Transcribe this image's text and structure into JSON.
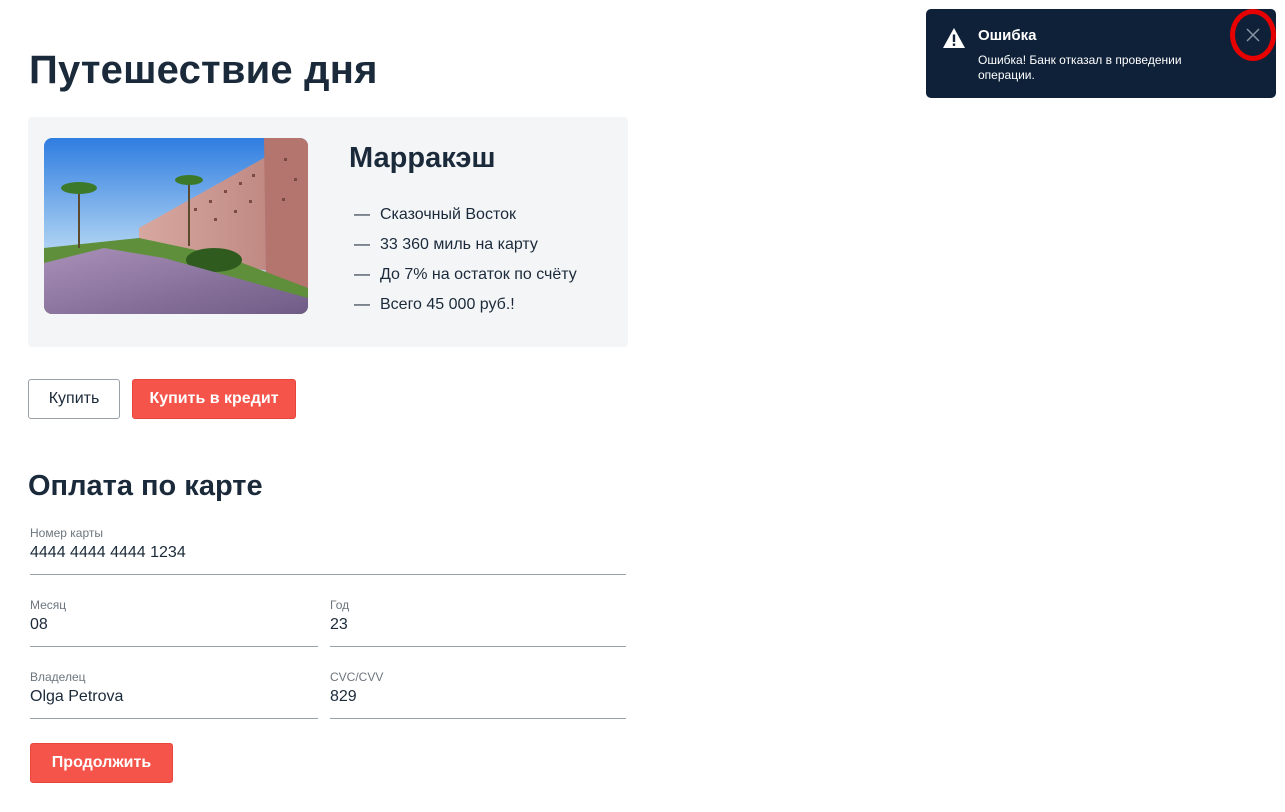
{
  "page": {
    "title": "Путешествие дня"
  },
  "offer": {
    "title": "Марракэш",
    "image_alt": "marrakesh-city-wall-photo",
    "features": [
      "Сказочный Восток",
      "33 360 миль на карту",
      "До 7% на остаток по счёту",
      "Всего 45 000 руб.!"
    ],
    "dash": "—"
  },
  "actions": {
    "buy_label": "Купить",
    "buy_credit_label": "Купить в кредит"
  },
  "payment": {
    "title": "Оплата по карте",
    "fields": {
      "card_number": {
        "label": "Номер карты",
        "value": "4444 4444 4444 1234"
      },
      "month": {
        "label": "Месяц",
        "value": "08"
      },
      "year": {
        "label": "Год",
        "value": "23"
      },
      "owner": {
        "label": "Владелец",
        "value": "Olga Petrova"
      },
      "cvc": {
        "label": "CVC/CVV",
        "value": "829"
      }
    },
    "continue_label": "Продолжить"
  },
  "notification": {
    "title": "Ошибка",
    "message": "Ошибка! Банк отказал в проведении операции.",
    "icon": "warning-icon",
    "close_icon": "close-icon",
    "highlight_color": "#e60000"
  },
  "colors": {
    "accent": "#f4544a",
    "text": "#1b2a3a",
    "toast_bg": "#0f2138",
    "card_bg": "#f4f5f7"
  }
}
